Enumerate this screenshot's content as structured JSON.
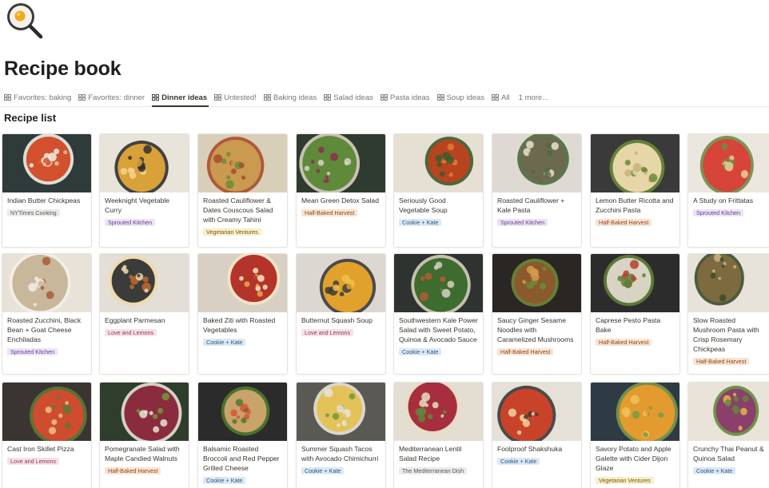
{
  "page": {
    "icon": "frying-pan-egg-icon",
    "title": "Recipe book"
  },
  "tabs": [
    {
      "label": "Favorites: baking",
      "active": false
    },
    {
      "label": "Favorites: dinner",
      "active": false
    },
    {
      "label": "Dinner ideas",
      "active": true
    },
    {
      "label": "Untested!",
      "active": false
    },
    {
      "label": "Baking ideas",
      "active": false
    },
    {
      "label": "Salad ideas",
      "active": false
    },
    {
      "label": "Pasta ideas",
      "active": false
    },
    {
      "label": "Soup ideas",
      "active": false
    },
    {
      "label": "All",
      "active": false
    }
  ],
  "more_tabs": "1 more...",
  "section_title": "Recipe list",
  "tag_colors": {
    "NYTimes Cooking": "gray",
    "Sprouted Kitchen": "purple",
    "Vegetarian Ventures": "yellow",
    "Half-Baked Harvest": "orange",
    "Cookie + Kate": "blue",
    "Love and Lemons": "pink",
    "The Mediterranean Dish": "gray"
  },
  "recipes": [
    {
      "title": "Indian Butter Chickpeas",
      "source": "NYTimes Cooking"
    },
    {
      "title": "Weeknight Vegetable Curry",
      "source": "Sprouted Kitchen"
    },
    {
      "title": "Roasted Cauliflower & Dates Couscous Salad with Creamy Tahini",
      "source": "Vegetarian Ventures"
    },
    {
      "title": "Mean Green Detox Salad",
      "source": "Half-Baked Harvest"
    },
    {
      "title": "Seriously Good Vegetable Soup",
      "source": "Cookie + Kate"
    },
    {
      "title": "Roasted Cauliflower + Kale Pasta",
      "source": "Sprouted Kitchen"
    },
    {
      "title": "Lemon Butter Ricotta and Zucchini Pasta",
      "source": "Half-Baked Harvest"
    },
    {
      "title": "A Study on Frittatas",
      "source": "Sprouted Kitchen"
    },
    {
      "title": "Roasted Zucchini, Black Bean + Goat Cheese Enchiladas",
      "source": "Sprouted Kitchen"
    },
    {
      "title": "Eggplant Parmesan",
      "source": "Love and Lemons"
    },
    {
      "title": "Baked Ziti with Roasted Vegetables",
      "source": "Cookie + Kate"
    },
    {
      "title": "Butternut Squash Soup",
      "source": "Love and Lemons"
    },
    {
      "title": "Southwestern Kale Power Salad with Sweet Potato, Quinoa & Avocado Sauce",
      "source": "Cookie + Kate"
    },
    {
      "title": "Saucy Ginger Sesame Noodles with Caramelized Mushrooms",
      "source": "Half-Baked Harvest"
    },
    {
      "title": "Caprese Pesto Pasta Bake",
      "source": "Half-Baked Harvest"
    },
    {
      "title": "Slow Roasted Mushroom Pasta with Crisp Rosemary Chickpeas",
      "source": "Half-Baked Harvest"
    },
    {
      "title": "Cast Iron Skillet Pizza",
      "source": "Love and Lemons"
    },
    {
      "title": "Pomegranate Salad with Maple Candied Walnuts",
      "source": "Half-Baked Harvest"
    },
    {
      "title": "Balsamic Roasted Broccoli and Red Pepper Grilled Cheese",
      "source": "Cookie + Kate"
    },
    {
      "title": "Summer Squash Tacos with Avocado Chimichurri",
      "source": "Cookie + Kate"
    },
    {
      "title": "Mediterranean Lentil Salad Recipe",
      "source": "The Mediterranean Dish"
    },
    {
      "title": "Foolproof Shakshuka",
      "source": "Cookie + Kate"
    },
    {
      "title": "Savory Potato and Apple Galette with Cider Dijon Glaze",
      "source": "Vegetarian Ventures"
    },
    {
      "title": "Crunchy Thai Peanut & Quinoa Salad",
      "source": "Cookie + Kate"
    }
  ]
}
